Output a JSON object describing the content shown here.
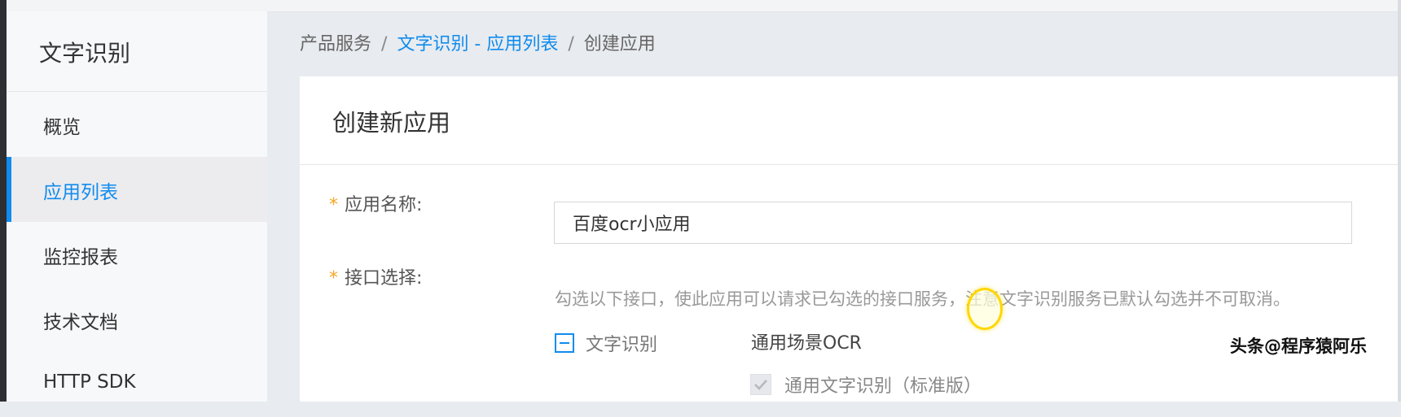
{
  "sidebar": {
    "title": "文字识别",
    "items": [
      {
        "label": "概览"
      },
      {
        "label": "应用列表"
      },
      {
        "label": "监控报表"
      },
      {
        "label": "技术文档"
      },
      {
        "label": "HTTP SDK"
      }
    ],
    "active_index": 1
  },
  "breadcrumb": {
    "items": [
      "产品服务",
      "文字识别 - 应用列表",
      "创建应用"
    ],
    "separator": "/"
  },
  "card": {
    "title": "创建新应用",
    "app_name": {
      "required_mark": "*",
      "label": "应用名称:",
      "value": "百度ocr小应用"
    },
    "api_select": {
      "required_mark": "*",
      "label": "接口选择:",
      "hint": "勾选以下接口，使此应用可以请求已勾选的接口服务，注意文字识别服务已默认勾选并不可取消。",
      "group_label": "文字识别",
      "scene_label": "通用场景OCR",
      "option_label": "通用文字识别（标准版）"
    }
  },
  "watermark": "头条@程序猿阿乐",
  "colors": {
    "accent": "#108cee",
    "required": "#f5a623",
    "sidebar_bg": "#f7f8fa",
    "page_bg": "#e8ebef"
  }
}
